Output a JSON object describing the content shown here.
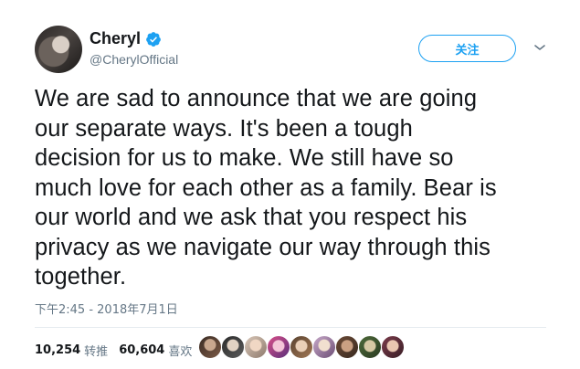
{
  "user": {
    "name": "Cheryl",
    "handle": "@CherylOfficial"
  },
  "follow_label": "关注",
  "tweet_lines": [
    "We are sad to announce that we are going",
    "our separate ways. It's been a tough",
    "decision for us to make. We still have so",
    "much love for each other as a family.  Bear is",
    "our world and we ask that you respect his",
    "privacy as we navigate our way through this",
    "together."
  ],
  "timestamp": "下午2:45 - 2018年7月1日",
  "stats": {
    "retweets_count": "10,254",
    "retweets_label": "转推",
    "likes_count": "60,604",
    "likes_label": "喜欢"
  },
  "colors": {
    "accent": "#1da1f2",
    "text": "#14171a",
    "muted": "#657786"
  },
  "icons": {
    "verified": "verified-badge-icon",
    "caret": "chevron-down-icon"
  }
}
